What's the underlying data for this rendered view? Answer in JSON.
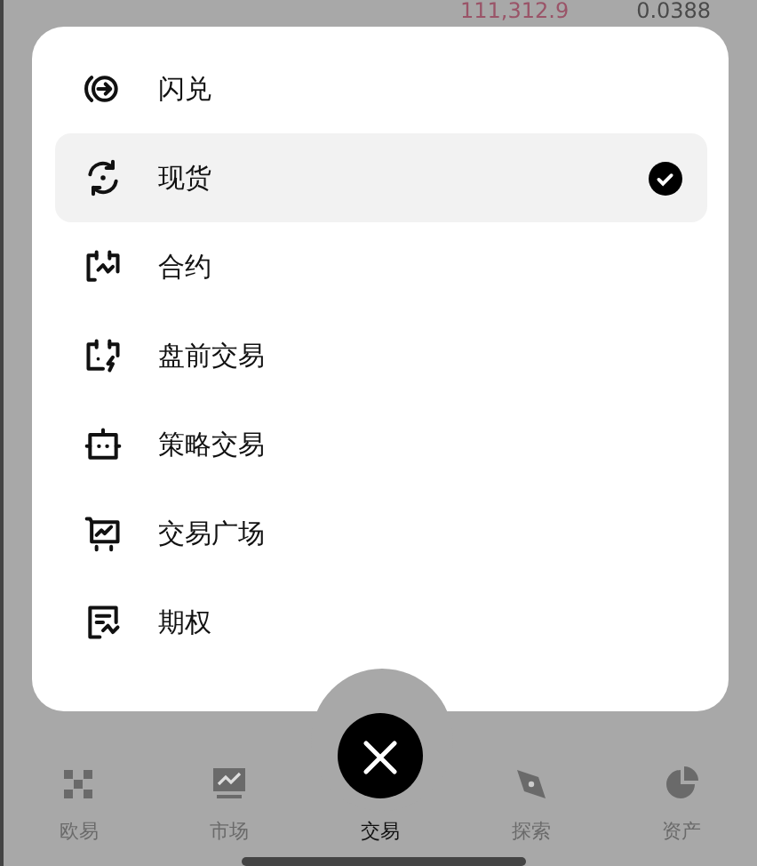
{
  "background": {
    "price": "111,312.9",
    "change": "0.0388"
  },
  "menu": {
    "items": [
      {
        "label": "闪兑",
        "selected": false
      },
      {
        "label": "现货",
        "selected": true
      },
      {
        "label": "合约",
        "selected": false
      },
      {
        "label": "盘前交易",
        "selected": false
      },
      {
        "label": "策略交易",
        "selected": false
      },
      {
        "label": "交易广场",
        "selected": false
      },
      {
        "label": "期权",
        "selected": false
      }
    ]
  },
  "tab_bar": {
    "tabs": [
      {
        "label": "欧易",
        "selected": false
      },
      {
        "label": "市场",
        "selected": false
      },
      {
        "label": "交易",
        "selected": true
      },
      {
        "label": "探索",
        "selected": false
      },
      {
        "label": "资产",
        "selected": false
      }
    ]
  }
}
